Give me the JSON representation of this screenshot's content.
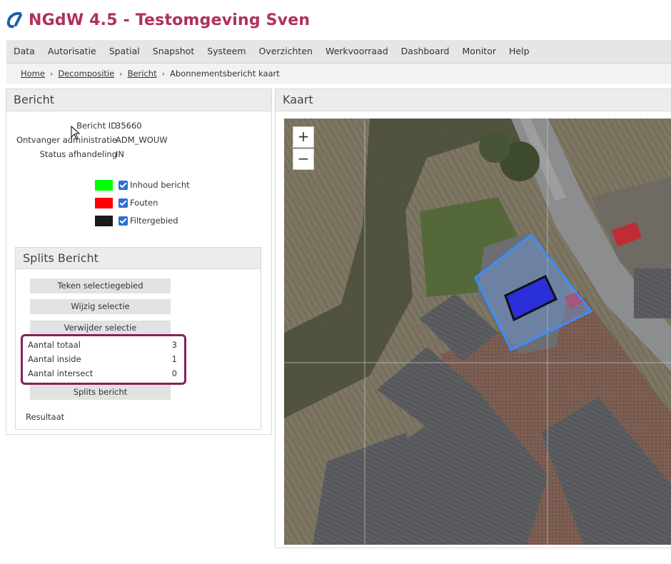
{
  "app": {
    "title": "NGdW 4.5 - Testomgeving Sven"
  },
  "menu": [
    "Data",
    "Autorisatie",
    "Spatial",
    "Snapshot",
    "Systeem",
    "Overzichten",
    "Werkvoorraad",
    "Dashboard",
    "Monitor",
    "Help"
  ],
  "breadcrumb": {
    "home": "Home",
    "decompositie": "Decompositie",
    "bericht": "Bericht",
    "current": "Abonnementsbericht kaart"
  },
  "bericht": {
    "title": "Bericht",
    "fields": [
      {
        "label": "Bericht ID",
        "value": "35660"
      },
      {
        "label": "Ontvanger administratie",
        "value": "ADM_WOUW"
      },
      {
        "label": "Status afhandeling",
        "value": "IN"
      }
    ],
    "legend": [
      {
        "label": "Inhoud bericht",
        "color": "#00ff00"
      },
      {
        "label": "Fouten",
        "color": "#ff0000"
      },
      {
        "label": "Filtergebied",
        "color": "#1a1a1a"
      }
    ]
  },
  "splits": {
    "title": "Splits Bericht",
    "buttons": {
      "teken": "Teken selectiegebied",
      "wijzig": "Wijzig selectie",
      "verwijder": "Verwijder selectie",
      "splits": "Splits bericht"
    },
    "stats": [
      {
        "label": "Aantal totaal",
        "value": "3"
      },
      {
        "label": "Aantal inside",
        "value": "1"
      },
      {
        "label": "Aantal intersect",
        "value": "0"
      }
    ],
    "result_label": "Resultaat"
  },
  "kaart": {
    "title": "Kaart",
    "zoom_in": "+",
    "zoom_out": "−"
  },
  "colors": {
    "brand": "#b0305a",
    "highlight": "#8a1f5a",
    "selection": "#3b8cff"
  }
}
